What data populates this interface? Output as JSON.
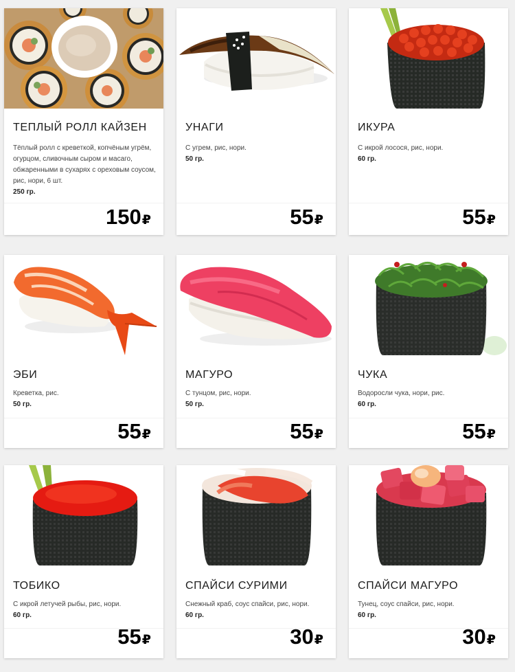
{
  "currency": "₽",
  "products": [
    {
      "title": "ТЕПЛЫЙ РОЛЛ КАЙЗЕН",
      "desc": "Тёплый ролл с креветкой, копчёным угрём, огурцом, сливочным сыром и масаго, обжаренными в сухарях с ореховым соусом, рис, нори, 6 шт.",
      "weight": "250 гр.",
      "price": "150",
      "image": "warm-roll-image"
    },
    {
      "title": "УНАГИ",
      "desc": "С угрем, рис, нори.",
      "weight": "50 гр.",
      "price": "55",
      "image": "unagi-nigiri-image"
    },
    {
      "title": "ИКУРА",
      "desc": "С икрой лосося, рис, нори.",
      "weight": "60 гр.",
      "price": "55",
      "image": "ikura-gunkan-image"
    },
    {
      "title": "ЭБИ",
      "desc": "Креветка, рис.",
      "weight": "50 гр.",
      "price": "55",
      "image": "ebi-nigiri-image"
    },
    {
      "title": "МАГУРО",
      "desc": "С тунцом, рис, нори.",
      "weight": "50 гр.",
      "price": "55",
      "image": "maguro-nigiri-image"
    },
    {
      "title": "ЧУКА",
      "desc": "Водоросли чука, нори, рис.",
      "weight": "60 гр.",
      "price": "55",
      "image": "chuka-gunkan-image"
    },
    {
      "title": "ТОБИКО",
      "desc": "С икрой летучей рыбы, рис, нори.",
      "weight": "60 гр.",
      "price": "55",
      "image": "tobiko-gunkan-image"
    },
    {
      "title": "СПАЙСИ СУРИМИ",
      "desc": "Снежный краб, соус спайси, рис, нори.",
      "weight": "60 гр.",
      "price": "30",
      "image": "spicy-surimi-gunkan-image"
    },
    {
      "title": "СПАЙСИ МАГУРО",
      "desc": "Тунец, соус спайси, рис, нори.",
      "weight": "60 гр.",
      "price": "30",
      "image": "spicy-maguro-gunkan-image"
    }
  ]
}
